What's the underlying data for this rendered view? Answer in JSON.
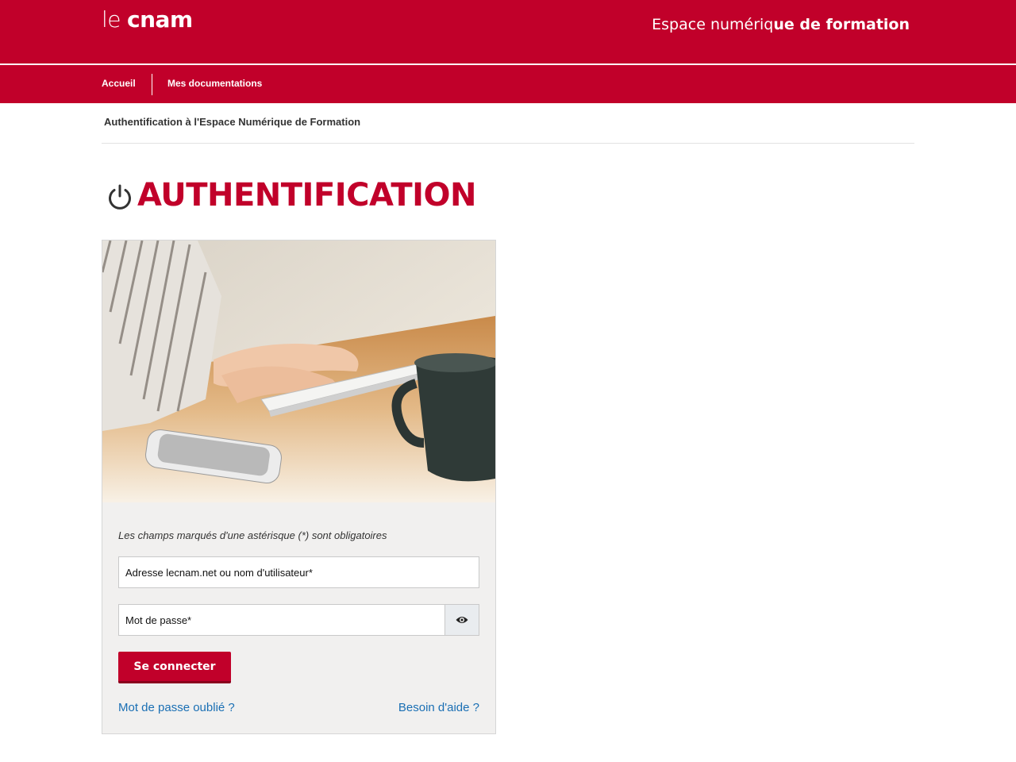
{
  "header": {
    "logo_le": "le",
    "logo_cnam": "cnam",
    "site_title_light": "Espace numériq",
    "site_title_bold": "ue de formation"
  },
  "nav": {
    "items": [
      {
        "label": "Accueil"
      },
      {
        "label": "Mes documentations"
      }
    ]
  },
  "breadcrumb": "Authentification à l'Espace Numérique de Formation",
  "page": {
    "title": "AUTHENTIFICATION",
    "title_icon": "power-icon"
  },
  "form": {
    "required_note": "Les champs marqués d'une astérisque (*) sont obligatoires",
    "username_placeholder": "Adresse lecnam.net ou nom d'utilisateur*",
    "password_placeholder": "Mot de passe*",
    "show_password_icon": "eye-icon",
    "submit_label": "Se connecter",
    "forgot_link": "Mot de passe oublié ?",
    "help_link": "Besoin d'aide ?"
  },
  "colors": {
    "brand": "#c1002a",
    "link": "#1a6fb4",
    "card_bg": "#f1f0ef"
  }
}
